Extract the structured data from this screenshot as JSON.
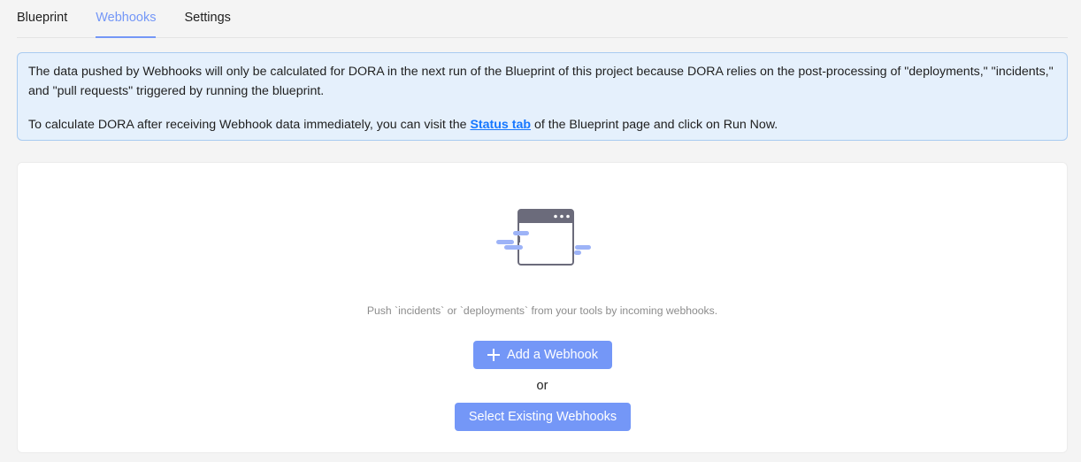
{
  "tabs": [
    {
      "label": "Blueprint",
      "active": false
    },
    {
      "label": "Webhooks",
      "active": true
    },
    {
      "label": "Settings",
      "active": false
    }
  ],
  "notice": {
    "line1": "The data pushed by Webhooks will only be calculated for DORA in the next run of the Blueprint of this project because DORA relies on the post-processing of \"deployments,\" \"incidents,\" and \"pull requests\" triggered by running the blueprint.",
    "line2_before": "To calculate DORA after receiving Webhook data immediately, you can visit the ",
    "line2_link": "Status tab",
    "line2_after": " of the Blueprint page and click on Run Now."
  },
  "empty_state": {
    "illustration": "webhook-window-icon",
    "description": "Push `incidents` or `deployments` from your tools by incoming webhooks.",
    "add_button_label": "Add a Webhook",
    "add_button_icon": "plus-icon",
    "or_label": "or",
    "select_button_label": "Select Existing Webhooks"
  },
  "colors": {
    "accent": "#7497f7",
    "link": "#1677ff",
    "notice_bg": "#e5f0fc",
    "notice_border": "#a9cbf1"
  }
}
